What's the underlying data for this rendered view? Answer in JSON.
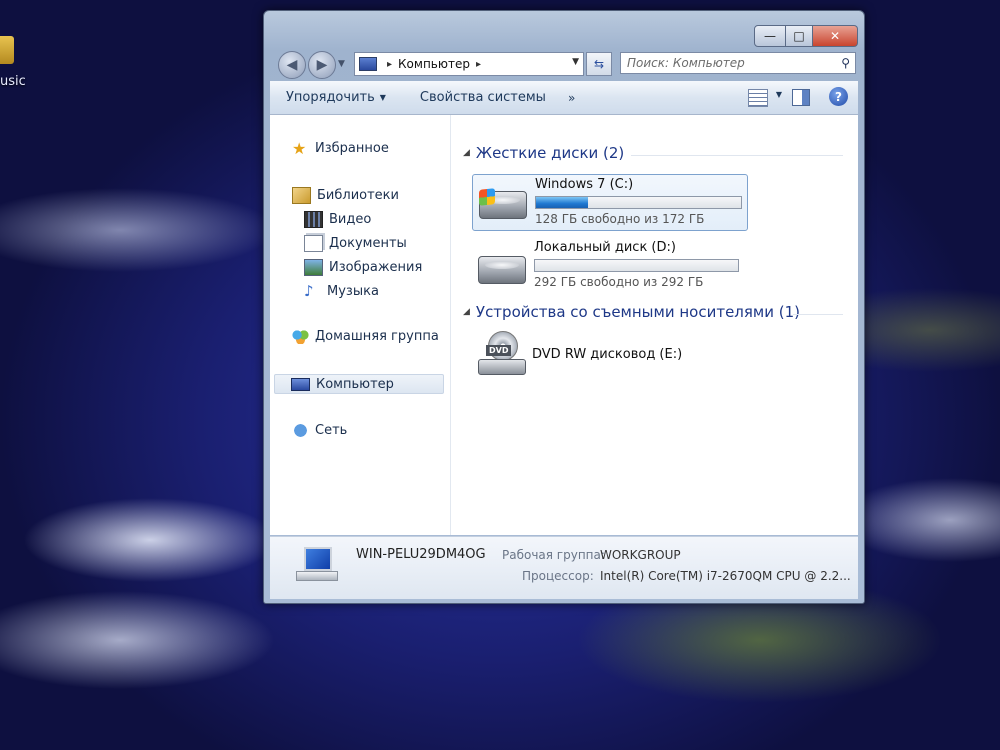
{
  "desktop": {
    "icon_label": "usic"
  },
  "window": {
    "caption": {
      "minimize": "—",
      "maximize": "□",
      "close": "✕"
    },
    "address": {
      "location": "Компьютер",
      "separator": "▸"
    },
    "search": {
      "placeholder": "Поиск: Компьютер"
    },
    "toolbar": {
      "organize": "Упорядочить",
      "system_properties": "Свойства системы",
      "more": "»"
    },
    "nav": {
      "favorites": "Избранное",
      "libraries": "Библиотеки",
      "video": "Видео",
      "documents": "Документы",
      "images": "Изображения",
      "music": "Музыка",
      "homegroup": "Домашняя группа",
      "computer": "Компьютер",
      "network": "Сеть"
    },
    "groups": {
      "hard_disks": "Жесткие диски (2)",
      "removable": "Устройства со съемными носителями (1)"
    },
    "drives": [
      {
        "name": "Windows 7 (C:)",
        "free": "128 ГБ свободно из 172 ГБ",
        "used_fraction": 0.256
      },
      {
        "name": "Локальный диск (D:)",
        "free": "292 ГБ свободно из 292 ГБ",
        "used_fraction": 0.0
      }
    ],
    "dvd": {
      "name": "DVD RW дисковод (E:)",
      "badge": "DVD"
    },
    "details": {
      "computer_name": "WIN-PELU29DM4OG",
      "workgroup_label": "Рабочая группа:",
      "workgroup": "WORKGROUP",
      "cpu_label": "Процессор:",
      "cpu": "Intel(R) Core(TM) i7-2670QM CPU @ 2.2..."
    }
  },
  "colors": {
    "accent": "#1e3887",
    "progress": "#1f78d1"
  }
}
